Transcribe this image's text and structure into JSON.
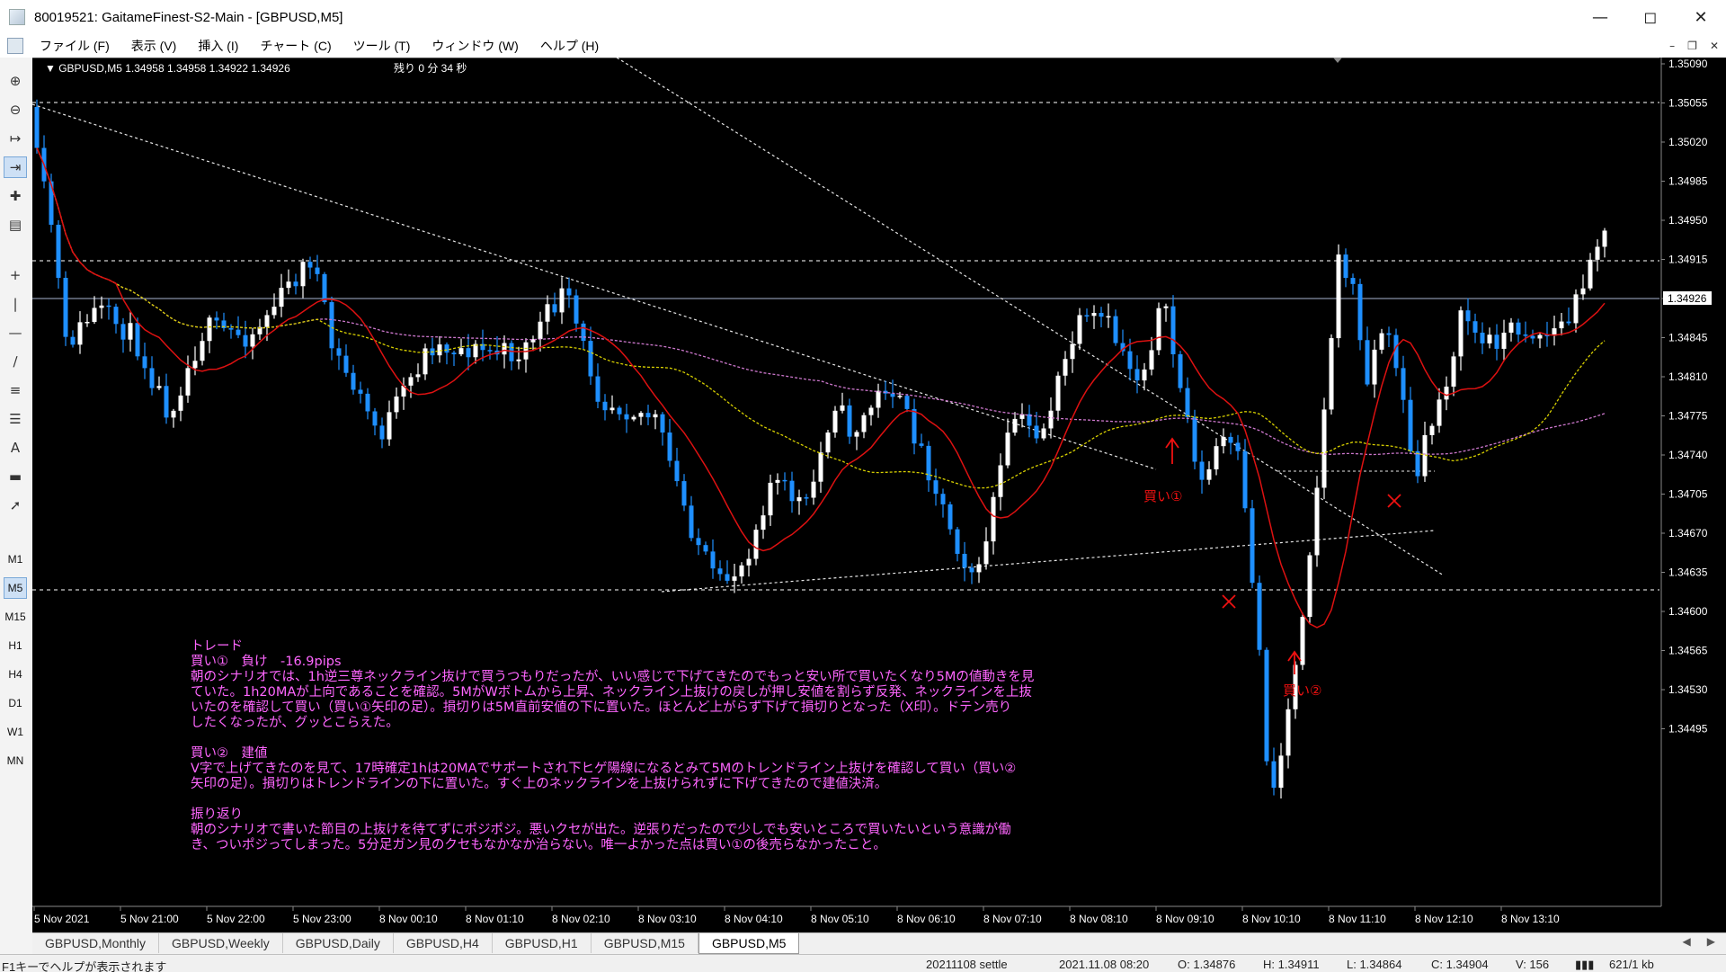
{
  "window": {
    "title": "80019521: GaitameFinest-S2-Main - [GBPUSD,M5]"
  },
  "menu": [
    "ファイル (F)",
    "表示 (V)",
    "挿入 (I)",
    "チャート (C)",
    "ツール (T)",
    "ウィンドウ (W)",
    "ヘルプ (H)"
  ],
  "timeframes": [
    "M1",
    "M5",
    "M15",
    "H1",
    "H4",
    "D1",
    "W1",
    "MN"
  ],
  "chart": {
    "header": "GBPUSD,M5  1.34958 1.34958 1.34922 1.34926",
    "remaining": "残り 0 分 34 秒",
    "price_labels": [
      "1.35090",
      "1.35055",
      "1.35020",
      "1.34985",
      "1.34950",
      "1.34915",
      "1.34880",
      "1.34845",
      "1.34810",
      "1.34775",
      "1.34740",
      "1.34705",
      "1.34670",
      "1.34635",
      "1.34600",
      "1.34565",
      "1.34530",
      "1.34495"
    ],
    "current_price": "1.34926",
    "time_labels": [
      "5 Nov 2021",
      "5 Nov 21:00",
      "5 Nov 22:00",
      "5 Nov 23:00",
      "8 Nov 00:10",
      "8 Nov 01:10",
      "8 Nov 02:10",
      "8 Nov 03:10",
      "8 Nov 04:10",
      "8 Nov 05:10",
      "8 Nov 06:10",
      "8 Nov 07:10",
      "8 Nov 08:10",
      "8 Nov 09:10",
      "8 Nov 10:10",
      "8 Nov 11:10",
      "8 Nov 12:10",
      "8 Nov 13:10"
    ],
    "annotations": {
      "buy1": "買い①",
      "buy2": "買い②"
    }
  },
  "notes": {
    "l1": "トレード",
    "l2": "買い①　負け　-16.9pips",
    "l3": "朝のシナリオでは、1h逆三尊ネックライン抜けで買うつもりだったが、いい感じで下げてきたのでもっと安い所で買いたくなり5Mの値動きを見",
    "l4": "ていた。1h20MAが上向であることを確認。5MがWボトムから上昇、ネックライン上抜けの戻しが押し安値を割らず反発、ネックラインを上抜",
    "l5": "いたのを確認して買い（買い①矢印の足）。損切りは5M直前安値の下に置いた。ほとんど上がらず下げて損切りとなった（X印）。ドテン売り",
    "l6": "したくなったが、グッとこらえた。",
    "l7": "買い②　建値",
    "l8": "V字で上げてきたのを見て、17時確定1hは20MAでサポートされ下ヒゲ陽線になるとみて5Mのトレンドライン上抜けを確認して買い（買い②",
    "l9": "矢印の足）。損切りはトレンドラインの下に置いた。すぐ上のネックラインを上抜けられずに下げてきたので建値決済。",
    "l10": "振り返り",
    "l11": "朝のシナリオで書いた節目の上抜けを待てずにポジポジ。悪いクセが出た。逆張りだったので少しでも安いところで買いたいという意識が働",
    "l12": "き、ついポジってしまった。5分足ガン見のクセもなかなか治らない。唯一よかった点は買い①の後売らなかったこと。"
  },
  "tabs": [
    "GBPUSD,Monthly",
    "GBPUSD,Weekly",
    "GBPUSD,Daily",
    "GBPUSD,H4",
    "GBPUSD,H1",
    "GBPUSD,M15",
    "GBPUSD,M5"
  ],
  "status": {
    "help": "F1キーでヘルプが表示されます",
    "profile": "20211108 settle",
    "datetime": "2021.11.08 08:20",
    "open": "O: 1.34876",
    "high": "H: 1.34911",
    "low": "L: 1.34864",
    "close": "C: 1.34904",
    "volume": "V: 156",
    "traffic": "621/1 kb"
  },
  "colors": {
    "bull": "#ffffff",
    "bear": "#1e8fff",
    "ma_fast": "#dd1111",
    "ma_mid": "#d8d000",
    "ma_slow": "#cc77cc",
    "note_text": "#ff66ff",
    "annotation": "#ee1111"
  }
}
